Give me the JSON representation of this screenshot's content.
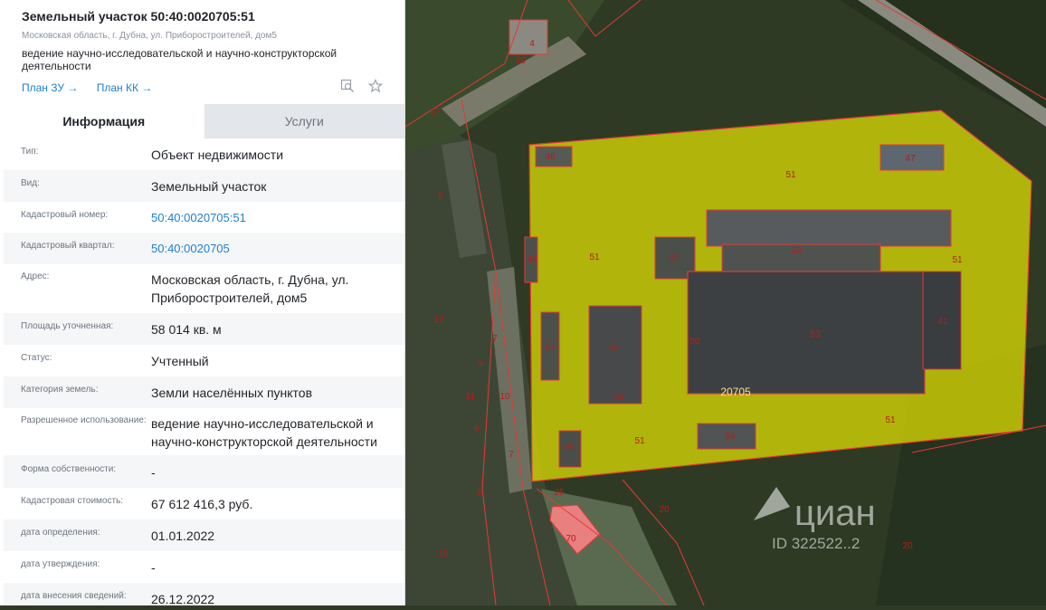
{
  "header": {
    "title": "Земельный участок 50:40:0020705:51",
    "address": "Московская область, г. Дубна, ул. Приборостроителей, дом5",
    "purpose": "ведение научно-исследовательской и научно-конструкторской деятельности",
    "link_plan_zu": "План ЗУ →",
    "link_plan_kk": "План КК →"
  },
  "tabs": [
    {
      "label": "Информация"
    },
    {
      "label": "Услуги"
    }
  ],
  "rows": [
    {
      "label": "Тип:",
      "value": "Объект недвижимости"
    },
    {
      "label": "Вид:",
      "value": "Земельный участок"
    },
    {
      "label": "Кадастровый номер:",
      "value": "50:40:0020705:51"
    },
    {
      "label": "Кадастровый квартал:",
      "value": "50:40:0020705"
    },
    {
      "label": "Адрес:",
      "value": "Московская область, г. Дубна, ул. Приборостроителей, дом5"
    },
    {
      "label": "Площадь уточненная:",
      "value": "58 014 кв. м"
    },
    {
      "label": "Статус:",
      "value": "Учтенный"
    },
    {
      "label": "Категория земель:",
      "value": "Земли населённых пунктов"
    },
    {
      "label": "Разрешенное использование:",
      "value": "ведение научно-исследовательской и научно-конструкторской деятельности"
    },
    {
      "label": "Форма собственности:",
      "value": "-"
    },
    {
      "label": "Кадастровая стоимость:",
      "value": "67 612 416,3 руб."
    },
    {
      "label": "дата определения:",
      "value": "01.01.2022"
    },
    {
      "label": "дата утверждения:",
      "value": "-"
    },
    {
      "label": "дата внесения сведений:",
      "value": "26.12.2022"
    }
  ],
  "map": {
    "parcel_labels": [
      "51",
      "51",
      "51",
      "51",
      "51",
      "46",
      "47",
      "49",
      "50",
      "48",
      "53",
      "52",
      "52",
      "41",
      "55",
      "56",
      "57",
      "50",
      "20705",
      "4",
      "38",
      "37",
      "8",
      "12",
      "7",
      "7",
      "9",
      "9",
      "9",
      "16",
      "25",
      "70",
      "20",
      "20",
      "10",
      "11"
    ],
    "watermark": "циан",
    "watermark_id": "ID 322522..2",
    "highlight_color": "#e5e300",
    "border_color": "#e53935"
  }
}
